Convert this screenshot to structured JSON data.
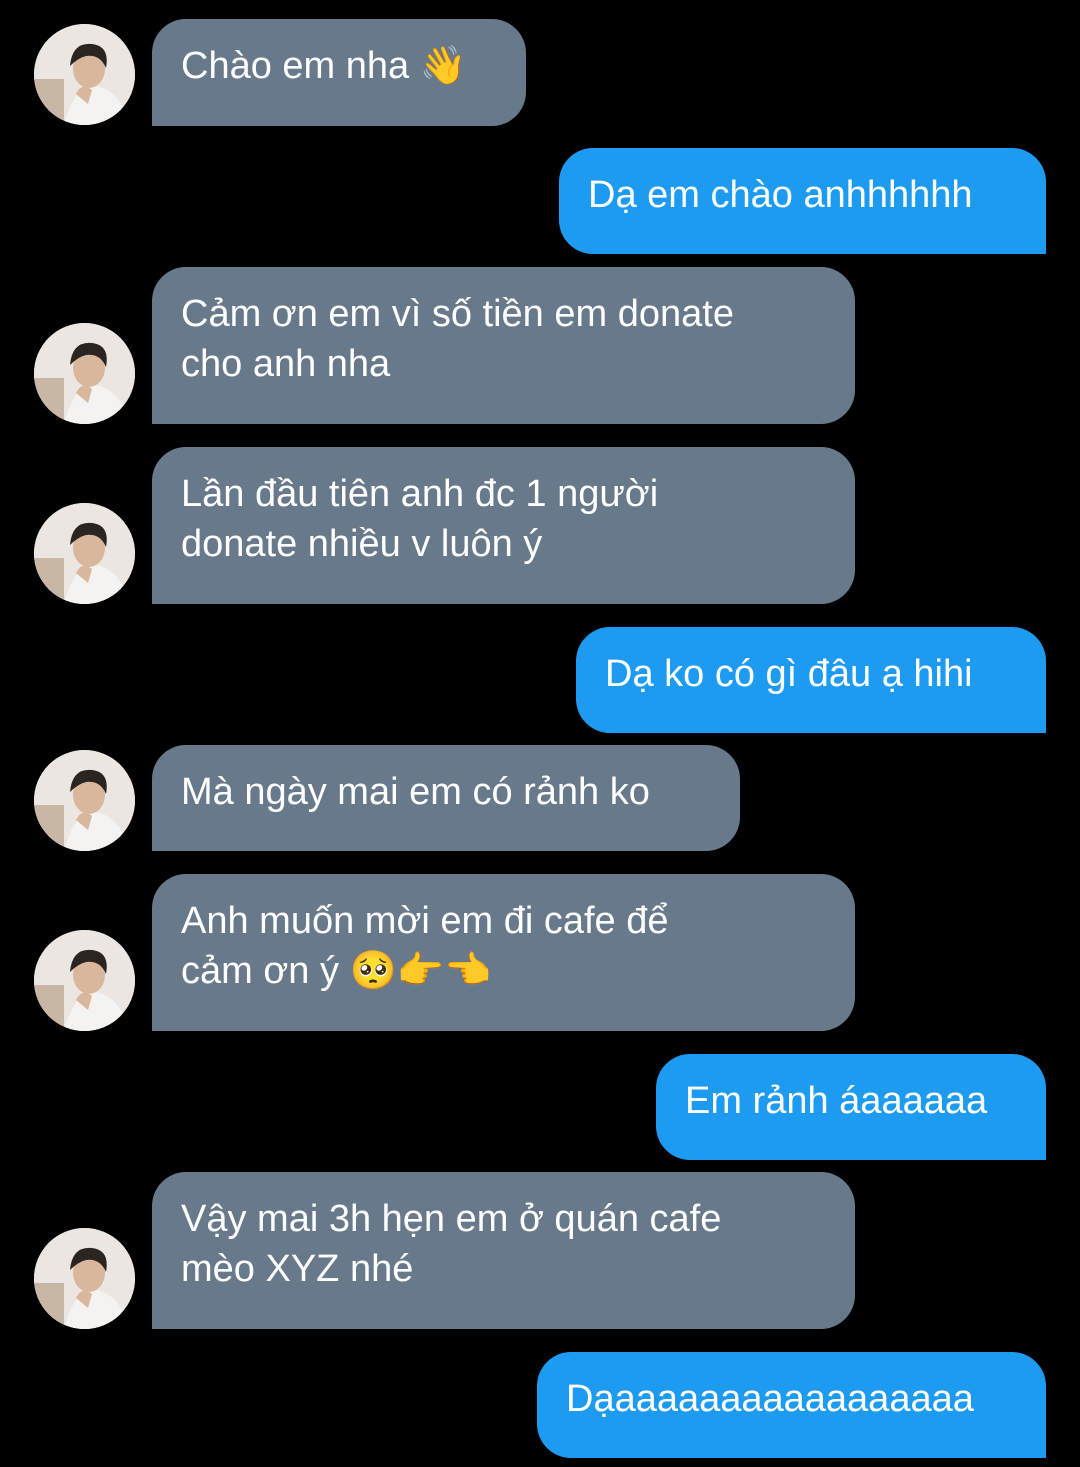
{
  "conversation": {
    "messages": [
      {
        "sender": "other",
        "text": "Chào em nha 👋"
      },
      {
        "sender": "me",
        "text": "Dạ em chào anhhhhhh"
      },
      {
        "sender": "other",
        "text": "Cảm ơn em vì số tiền em donate\ncho anh nha"
      },
      {
        "sender": "other",
        "text": "Lần đầu tiên anh đc 1 người\ndonate nhiều v luôn ý"
      },
      {
        "sender": "me",
        "text": "Dạ ko có gì đâu ạ hihi"
      },
      {
        "sender": "other",
        "text": "Mà ngày mai em có rảnh ko"
      },
      {
        "sender": "other",
        "text": "Anh muốn mời em đi cafe để\ncảm ơn ý 🥺👉👈"
      },
      {
        "sender": "me",
        "text": "Em rảnh áaaaaaa"
      },
      {
        "sender": "other",
        "text": "Vậy mai 3h hẹn em ở quán cafe\nmèo XYZ nhé"
      },
      {
        "sender": "me",
        "text": "Dạaaaaaaaaaaaaaaaaa"
      }
    ]
  },
  "colors": {
    "background": "#000000",
    "incoming_bubble": "#67798a",
    "outgoing_bubble": "#1d9bf0",
    "text": "#ffffff"
  },
  "icons": {
    "avatar": "profile-photo"
  }
}
